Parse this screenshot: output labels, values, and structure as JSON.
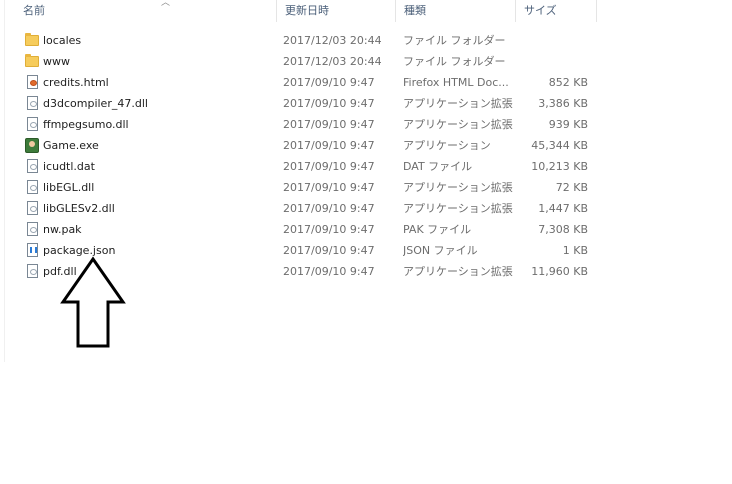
{
  "columns": {
    "name": "名前",
    "date": "更新日時",
    "type": "種類",
    "size": "サイズ"
  },
  "files": [
    {
      "name": "locales",
      "date": "2017/12/03 20:44",
      "type": "ファイル フォルダー",
      "size": "",
      "icon": "folder-icon"
    },
    {
      "name": "www",
      "date": "2017/12/03 20:44",
      "type": "ファイル フォルダー",
      "size": "",
      "icon": "folder-icon"
    },
    {
      "name": "credits.html",
      "date": "2017/09/10 9:47",
      "type": "Firefox HTML Doc...",
      "size": "852 KB",
      "icon": "html-file-icon"
    },
    {
      "name": "d3dcompiler_47.dll",
      "date": "2017/09/10 9:47",
      "type": "アプリケーション拡張",
      "size": "3,386 KB",
      "icon": "dll-file-icon"
    },
    {
      "name": "ffmpegsumo.dll",
      "date": "2017/09/10 9:47",
      "type": "アプリケーション拡張",
      "size": "939 KB",
      "icon": "dll-file-icon"
    },
    {
      "name": "Game.exe",
      "date": "2017/09/10 9:47",
      "type": "アプリケーション",
      "size": "45,344 KB",
      "icon": "game-exe-icon"
    },
    {
      "name": "icudtl.dat",
      "date": "2017/09/10 9:47",
      "type": "DAT ファイル",
      "size": "10,213 KB",
      "icon": "file-icon"
    },
    {
      "name": "libEGL.dll",
      "date": "2017/09/10 9:47",
      "type": "アプリケーション拡張",
      "size": "72 KB",
      "icon": "dll-file-icon"
    },
    {
      "name": "libGLESv2.dll",
      "date": "2017/09/10 9:47",
      "type": "アプリケーション拡張",
      "size": "1,447 KB",
      "icon": "dll-file-icon"
    },
    {
      "name": "nw.pak",
      "date": "2017/09/10 9:47",
      "type": "PAK ファイル",
      "size": "7,308 KB",
      "icon": "file-icon"
    },
    {
      "name": "package.json",
      "date": "2017/09/10 9:47",
      "type": "JSON ファイル",
      "size": "1 KB",
      "icon": "json-file-icon"
    },
    {
      "name": "pdf.dll",
      "date": "2017/09/10 9:47",
      "type": "アプリケーション拡張",
      "size": "11,960 KB",
      "icon": "dll-file-icon"
    }
  ],
  "annotation": {
    "icon": "up-arrow-icon",
    "color": "#000000"
  }
}
